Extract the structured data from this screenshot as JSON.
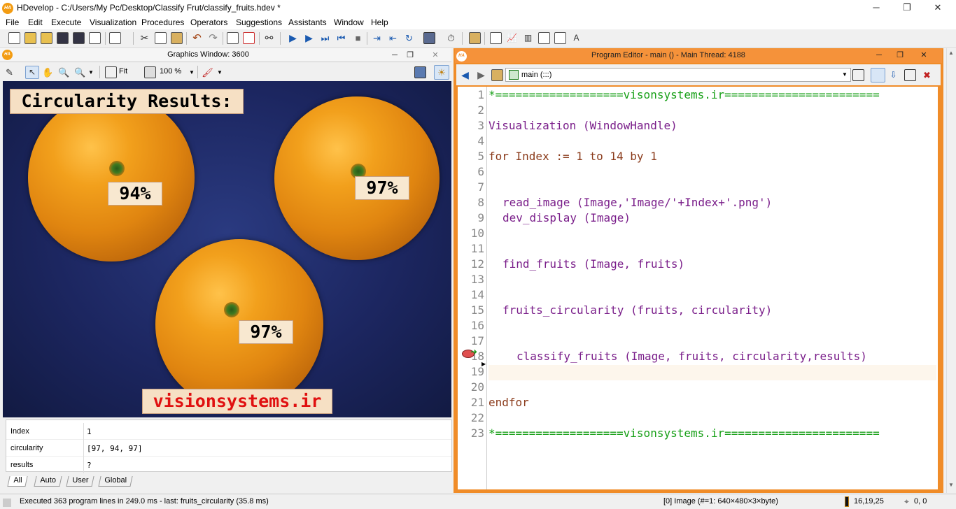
{
  "window": {
    "title": "HDevelop - C:/Users/My Pc/Desktop/Classify Frut/classify_fruits.hdev *",
    "app_icon": "HA",
    "controls": [
      "─",
      "❐",
      "✕"
    ]
  },
  "menu": [
    "File",
    "Edit",
    "Execute",
    "Visualization",
    "Procedures",
    "Operators",
    "Suggestions",
    "Assistants",
    "Window",
    "Help"
  ],
  "graphics_window": {
    "title": "Graphics Window: 3600",
    "zoom_fit": "Fit",
    "zoom_percent": "100 %",
    "overlay_title": "Circularity Results:",
    "labels": [
      "94%",
      "97%",
      "97%"
    ],
    "watermark": "visionsystems.ir"
  },
  "variables": [
    {
      "name": "Index",
      "value": "1"
    },
    {
      "name": "circularity",
      "value": "[97, 94, 97]"
    },
    {
      "name": "results",
      "value": "?"
    }
  ],
  "variable_tabs": [
    "All",
    "Auto",
    "User",
    "Global"
  ],
  "program_editor": {
    "title": "Program Editor - main () - Main Thread: 4188",
    "procedure": "main (:::)",
    "lines": [
      {
        "n": "1",
        "text": "*===================visonsystems.ir=======================",
        "style": "green",
        "indent": 0
      },
      {
        "n": "2",
        "text": "",
        "style": "plain",
        "indent": 0
      },
      {
        "n": "3",
        "text": "Visualization (WindowHandle)",
        "style": "purple",
        "indent": 0
      },
      {
        "n": "4",
        "text": "",
        "style": "plain",
        "indent": 0
      },
      {
        "n": "5",
        "text": "for Index := 1 to 14 by 1",
        "style": "brown",
        "indent": 0
      },
      {
        "n": "6",
        "text": "",
        "style": "plain",
        "indent": 0
      },
      {
        "n": "7",
        "text": "",
        "style": "plain",
        "indent": 0
      },
      {
        "n": "8",
        "text": "read_image (Image,'Image/'+Index+'.png')",
        "style": "purple",
        "indent": 1
      },
      {
        "n": "9",
        "text": "dev_display (Image)",
        "style": "purple",
        "indent": 1
      },
      {
        "n": "10",
        "text": "",
        "style": "plain",
        "indent": 0
      },
      {
        "n": "11",
        "text": "",
        "style": "plain",
        "indent": 0
      },
      {
        "n": "12",
        "text": "find_fruits (Image, fruits)",
        "style": "purple",
        "indent": 1
      },
      {
        "n": "13",
        "text": "",
        "style": "plain",
        "indent": 0
      },
      {
        "n": "14",
        "text": "",
        "style": "plain",
        "indent": 0
      },
      {
        "n": "15",
        "text": "fruits_circularity (fruits, circularity)",
        "style": "purple",
        "indent": 1
      },
      {
        "n": "16",
        "text": "",
        "style": "plain",
        "indent": 0
      },
      {
        "n": "17",
        "text": "",
        "style": "plain",
        "indent": 0
      },
      {
        "n": "18",
        "text": "classify_fruits (Image, fruits, circularity,results)",
        "style": "purple",
        "indent": 2
      },
      {
        "n": "19",
        "text": "",
        "style": "plain",
        "indent": 0
      },
      {
        "n": "20",
        "text": "",
        "style": "plain",
        "indent": 0
      },
      {
        "n": "21",
        "text": "endfor",
        "style": "brown",
        "indent": 0
      },
      {
        "n": "22",
        "text": "",
        "style": "plain",
        "indent": 0
      },
      {
        "n": "23",
        "text": "*===================visonsystems.ir=======================",
        "style": "green",
        "indent": 0
      }
    ]
  },
  "status": {
    "message": "Executed 363 program lines in 249.0 ms - last: fruits_circularity (35.8 ms)",
    "image_info": "[0] Image (#=1: 640×480×3×byte)",
    "color_value": "16,19,25",
    "coords": "0, 0"
  }
}
